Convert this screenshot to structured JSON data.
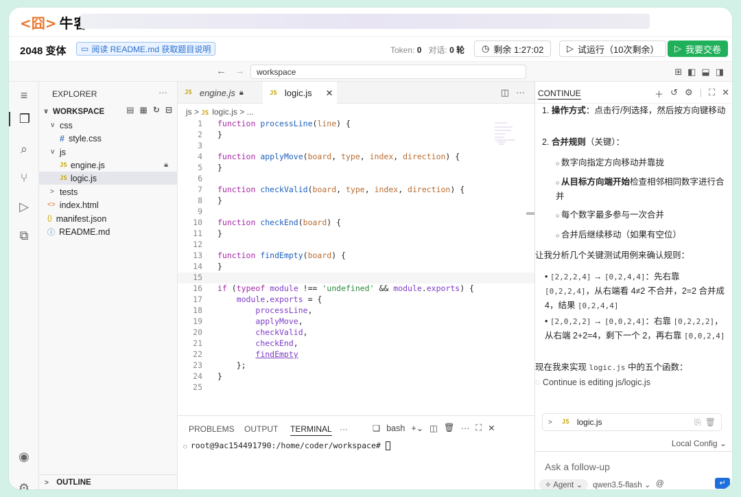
{
  "brand": {
    "logo_mark": "<囧>",
    "name": "牛客"
  },
  "header": {
    "title": "2048 变体",
    "readme_button": "阅读 README.md 获取题目说明",
    "token_label": "Token:",
    "token_value": "0",
    "dialog_label": "对话:",
    "dialog_value": "0 轮",
    "timer": "剩余 1:27:02",
    "trial_run": "试运行（10次剩余）",
    "submit": "我要交卷"
  },
  "nav": {
    "path": "workspace"
  },
  "explorer": {
    "title": "EXPLORER",
    "workspace": "WORKSPACE",
    "items": [
      {
        "label": "css",
        "type": "folder"
      },
      {
        "label": "style.css",
        "type": "css"
      },
      {
        "label": "js",
        "type": "folder"
      },
      {
        "label": "engine.js",
        "type": "js"
      },
      {
        "label": "logic.js",
        "type": "js"
      },
      {
        "label": "tests",
        "type": "folder"
      },
      {
        "label": "index.html",
        "type": "html"
      },
      {
        "label": "manifest.json",
        "type": "json"
      },
      {
        "label": "README.md",
        "type": "info"
      }
    ],
    "outline": "OUTLINE"
  },
  "editor": {
    "tabs": [
      {
        "label": "engine.js",
        "active": false
      },
      {
        "label": "logic.js",
        "active": true
      }
    ],
    "breadcrumb": [
      "js",
      ">",
      "logic.js",
      ">",
      "..."
    ],
    "lines": [
      "function processLine(line) {",
      "}",
      "",
      "function applyMove(board, type, index, direction) {",
      "}",
      "",
      "function checkValid(board, type, index, direction) {",
      "}",
      "",
      "function checkEnd(board) {",
      "}",
      "",
      "function findEmpty(board) {",
      "}",
      "",
      "if (typeof module !== 'undefined' && module.exports) {",
      "    module.exports = {",
      "        processLine,",
      "        applyMove,",
      "        checkValid,",
      "        checkEnd,",
      "        findEmpty",
      "    };",
      "}",
      ""
    ]
  },
  "panel": {
    "tabs": [
      "PROBLEMS",
      "OUTPUT",
      "TERMINAL",
      "···"
    ],
    "shell": "bash",
    "prompt": "root@9ac154491790:/home/coder/workspace# "
  },
  "chat": {
    "title": "CONTINUE",
    "item1_title": "操作方式",
    "item1_text": "：点击行/列选择，然后按方向键移动",
    "item2_title": "合并规则",
    "item2_text": "（关键）：",
    "sub1": "数字向指定方向移动并靠拢",
    "sub2_bold": "从目标方向端开始",
    "sub2_text": "检查相邻相同数字进行合并",
    "sub3": "每个数字最多参与一次合并",
    "sub4": "合并后继续移动（如果有空位）",
    "analysis": "让我分析几个关键测试用例来确认规则：",
    "case1_a": "[2,2,2,4]",
    "case1_b": "→",
    "case1_c": "[0,2,4,4]",
    "case1_d": "：先右靠",
    "case1_e": "[0,2,2,4]",
    "case1_f": "，从右端看 4≠2 不合并，2=2 合并成 4，结果",
    "case1_g": "[0,2,4,4]",
    "case2_a": "[2,0,2,2]",
    "case2_b": "→",
    "case2_c": "[0,0,2,4]",
    "case2_d": "：右靠",
    "case2_e": "[0,2,2,2]",
    "case2_f": "，从右端 2+2=4，剩下一个 2，再右靠",
    "case2_g": "[0,0,2,4]",
    "now_prefix": "现在我来实现",
    "now_code": "logic.js",
    "now_suffix": "中的五个函数：",
    "status": "Continue is editing js/logic.js",
    "file_card": "logic.js",
    "local_config": "Local Config",
    "input_placeholder": "Ask a follow-up",
    "agent": "Agent",
    "model": "qwen3.5-flash",
    "at": "@"
  }
}
